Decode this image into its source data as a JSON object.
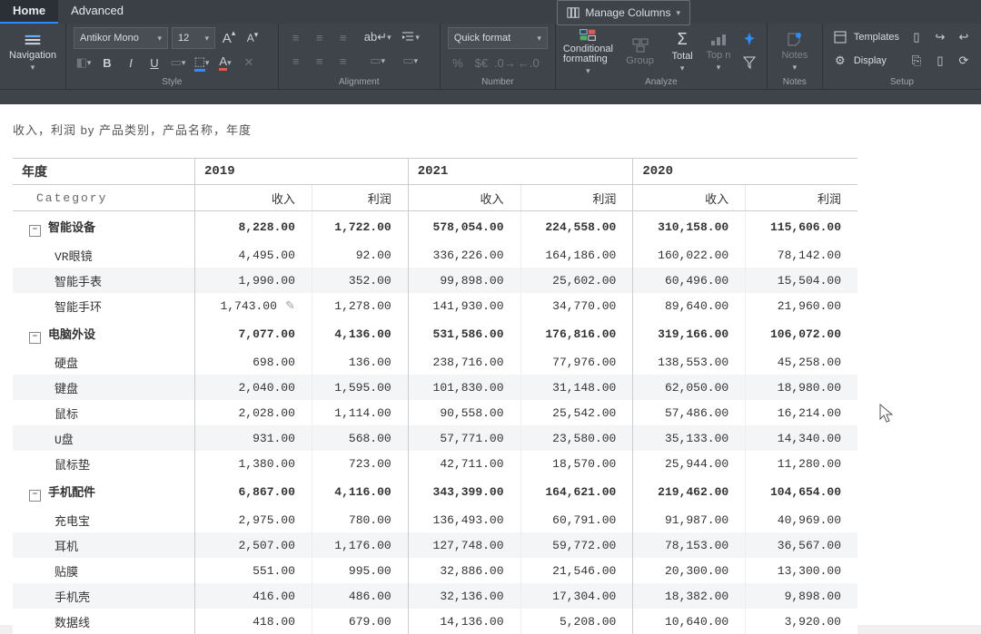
{
  "tabs": {
    "home": "Home",
    "advanced": "Advanced"
  },
  "ribbon": {
    "manage_columns": "Manage Columns",
    "navigation": "Navigation",
    "font_family": "Antikor Mono",
    "font_size": "12",
    "quick_format": "Quick format",
    "conditional_formatting": "Conditional formatting",
    "group": "Group",
    "total": "Total",
    "top_n": "Top n",
    "notes": "Notes",
    "templates": "Templates",
    "display": "Display",
    "group_labels": {
      "style": "Style",
      "alignment": "Alignment",
      "number": "Number",
      "analyze": "Analyze",
      "notes": "Notes",
      "setup": "Setup"
    }
  },
  "report": {
    "title": "收入，利润 by 产品类别，产品名称，年度",
    "dim_year": "年度",
    "dim_category": "Category",
    "years": [
      "2019",
      "2021",
      "2020"
    ],
    "measures": [
      "收入",
      "利润"
    ],
    "categories": [
      {
        "name": "智能设备",
        "totals": [
          "8,228.00",
          "1,722.00",
          "578,054.00",
          "224,558.00",
          "310,158.00",
          "115,606.00"
        ],
        "rows": [
          {
            "name": "VR眼镜",
            "v": [
              "4,495.00",
              "92.00",
              "336,226.00",
              "164,186.00",
              "160,022.00",
              "78,142.00"
            ]
          },
          {
            "name": "智能手表",
            "v": [
              "1,990.00",
              "352.00",
              "99,898.00",
              "25,602.00",
              "60,496.00",
              "15,504.00"
            ]
          },
          {
            "name": "智能手环",
            "v": [
              "1,743.00",
              "1,278.00",
              "141,930.00",
              "34,770.00",
              "89,640.00",
              "21,960.00"
            ],
            "edit": true
          }
        ]
      },
      {
        "name": "电脑外设",
        "totals": [
          "7,077.00",
          "4,136.00",
          "531,586.00",
          "176,816.00",
          "319,166.00",
          "106,072.00"
        ],
        "rows": [
          {
            "name": "硬盘",
            "v": [
              "698.00",
              "136.00",
              "238,716.00",
              "77,976.00",
              "138,553.00",
              "45,258.00"
            ]
          },
          {
            "name": "键盘",
            "v": [
              "2,040.00",
              "1,595.00",
              "101,830.00",
              "31,148.00",
              "62,050.00",
              "18,980.00"
            ]
          },
          {
            "name": "鼠标",
            "v": [
              "2,028.00",
              "1,114.00",
              "90,558.00",
              "25,542.00",
              "57,486.00",
              "16,214.00"
            ]
          },
          {
            "name": "U盘",
            "v": [
              "931.00",
              "568.00",
              "57,771.00",
              "23,580.00",
              "35,133.00",
              "14,340.00"
            ]
          },
          {
            "name": "鼠标垫",
            "v": [
              "1,380.00",
              "723.00",
              "42,711.00",
              "18,570.00",
              "25,944.00",
              "11,280.00"
            ]
          }
        ]
      },
      {
        "name": "手机配件",
        "totals": [
          "6,867.00",
          "4,116.00",
          "343,399.00",
          "164,621.00",
          "219,462.00",
          "104,654.00"
        ],
        "rows": [
          {
            "name": "充电宝",
            "v": [
              "2,975.00",
              "780.00",
              "136,493.00",
              "60,791.00",
              "91,987.00",
              "40,969.00"
            ]
          },
          {
            "name": "耳机",
            "v": [
              "2,507.00",
              "1,176.00",
              "127,748.00",
              "59,772.00",
              "78,153.00",
              "36,567.00"
            ]
          },
          {
            "name": "贴膜",
            "v": [
              "551.00",
              "995.00",
              "32,886.00",
              "21,546.00",
              "20,300.00",
              "13,300.00"
            ]
          },
          {
            "name": "手机壳",
            "v": [
              "416.00",
              "486.00",
              "32,136.00",
              "17,304.00",
              "18,382.00",
              "9,898.00"
            ]
          },
          {
            "name": "数据线",
            "v": [
              "418.00",
              "679.00",
              "14,136.00",
              "5,208.00",
              "10,640.00",
              "3,920.00"
            ]
          }
        ]
      }
    ]
  }
}
